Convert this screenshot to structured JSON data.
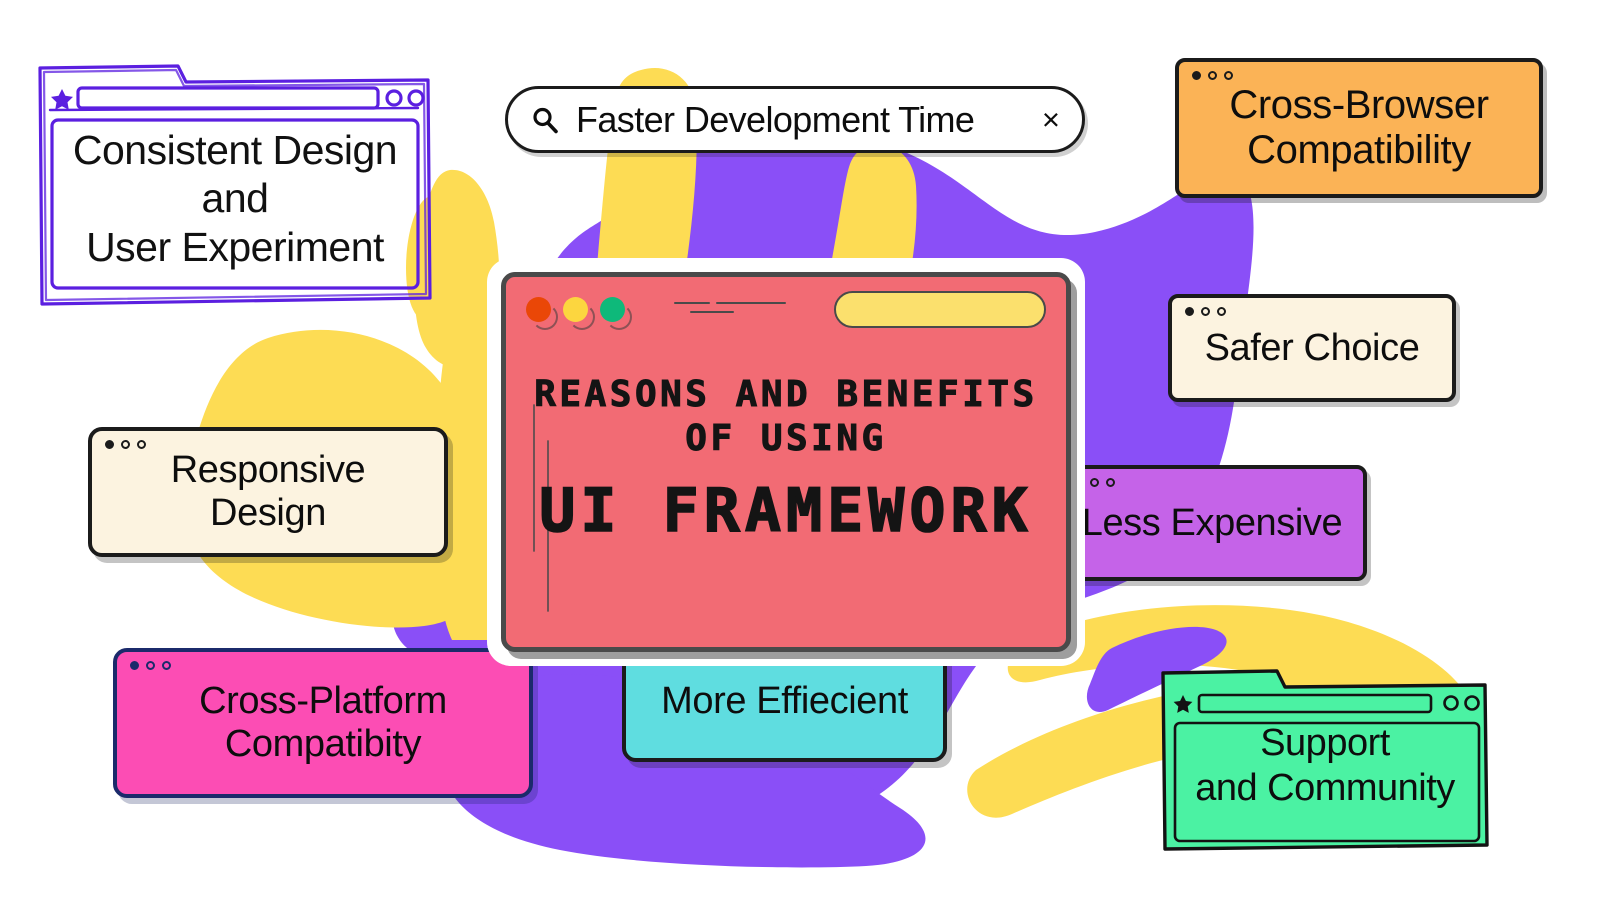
{
  "palette": {
    "background": "#FFFFFF",
    "purple_blob": "#8A4FF7",
    "yellow_stroke": "#FDDC54",
    "hero_red": "#F26B74",
    "orange_card": "#FBB356",
    "cream_card": "#FCF3E0",
    "magenta_card": "#C563E8",
    "pink_card": "#FC4DB4",
    "cyan_card": "#5FDDE0",
    "green_card": "#4BF2A3",
    "violet_outline": "#5B1FE0",
    "ink": "#1B1B1B",
    "navy_outline": "#1B2A6B",
    "traffic_red": "#EA4707",
    "traffic_yellow": "#FCD63F",
    "traffic_green": "#0EB97A",
    "hero_urlbar_yellow": "#FBE06D"
  },
  "search": {
    "icon": "search-icon",
    "value": "Faster Development Time",
    "placeholder": "Search",
    "clear_icon": "×"
  },
  "hero": {
    "title_line_1": "Reasons and Benefits",
    "title_line_2": "of Using",
    "title_line_3": "UI Framework",
    "window_controls": [
      "close",
      "minimize",
      "maximize"
    ],
    "urlbar_value": ""
  },
  "cards": {
    "consistent_design": {
      "label": "Consistent Design\nand\nUser Experiment",
      "style": "outlined-browser",
      "accent": "#5B1FE0"
    },
    "cross_browser": {
      "label": "Cross-Browser\nCompatibility",
      "style": "solid-card",
      "accent": "#FBB356"
    },
    "safer_choice": {
      "label": "Safer Choice",
      "style": "solid-card",
      "accent": "#FCF3E0"
    },
    "less_expensive": {
      "label": "Less Expensive",
      "style": "solid-card",
      "accent": "#C563E8"
    },
    "responsive_design": {
      "label": "Responsive Design",
      "style": "solid-card",
      "accent": "#FCF3E0"
    },
    "cross_platform": {
      "label": "Cross-Platform\nCompatibity",
      "style": "solid-card",
      "accent": "#FC4DB4"
    },
    "more_efficient": {
      "label": "More Effiecient",
      "style": "solid-card",
      "accent": "#5FDDE0"
    },
    "support_community": {
      "label": "Support\nand Community",
      "style": "solid-browser",
      "accent": "#4BF2A3"
    }
  }
}
